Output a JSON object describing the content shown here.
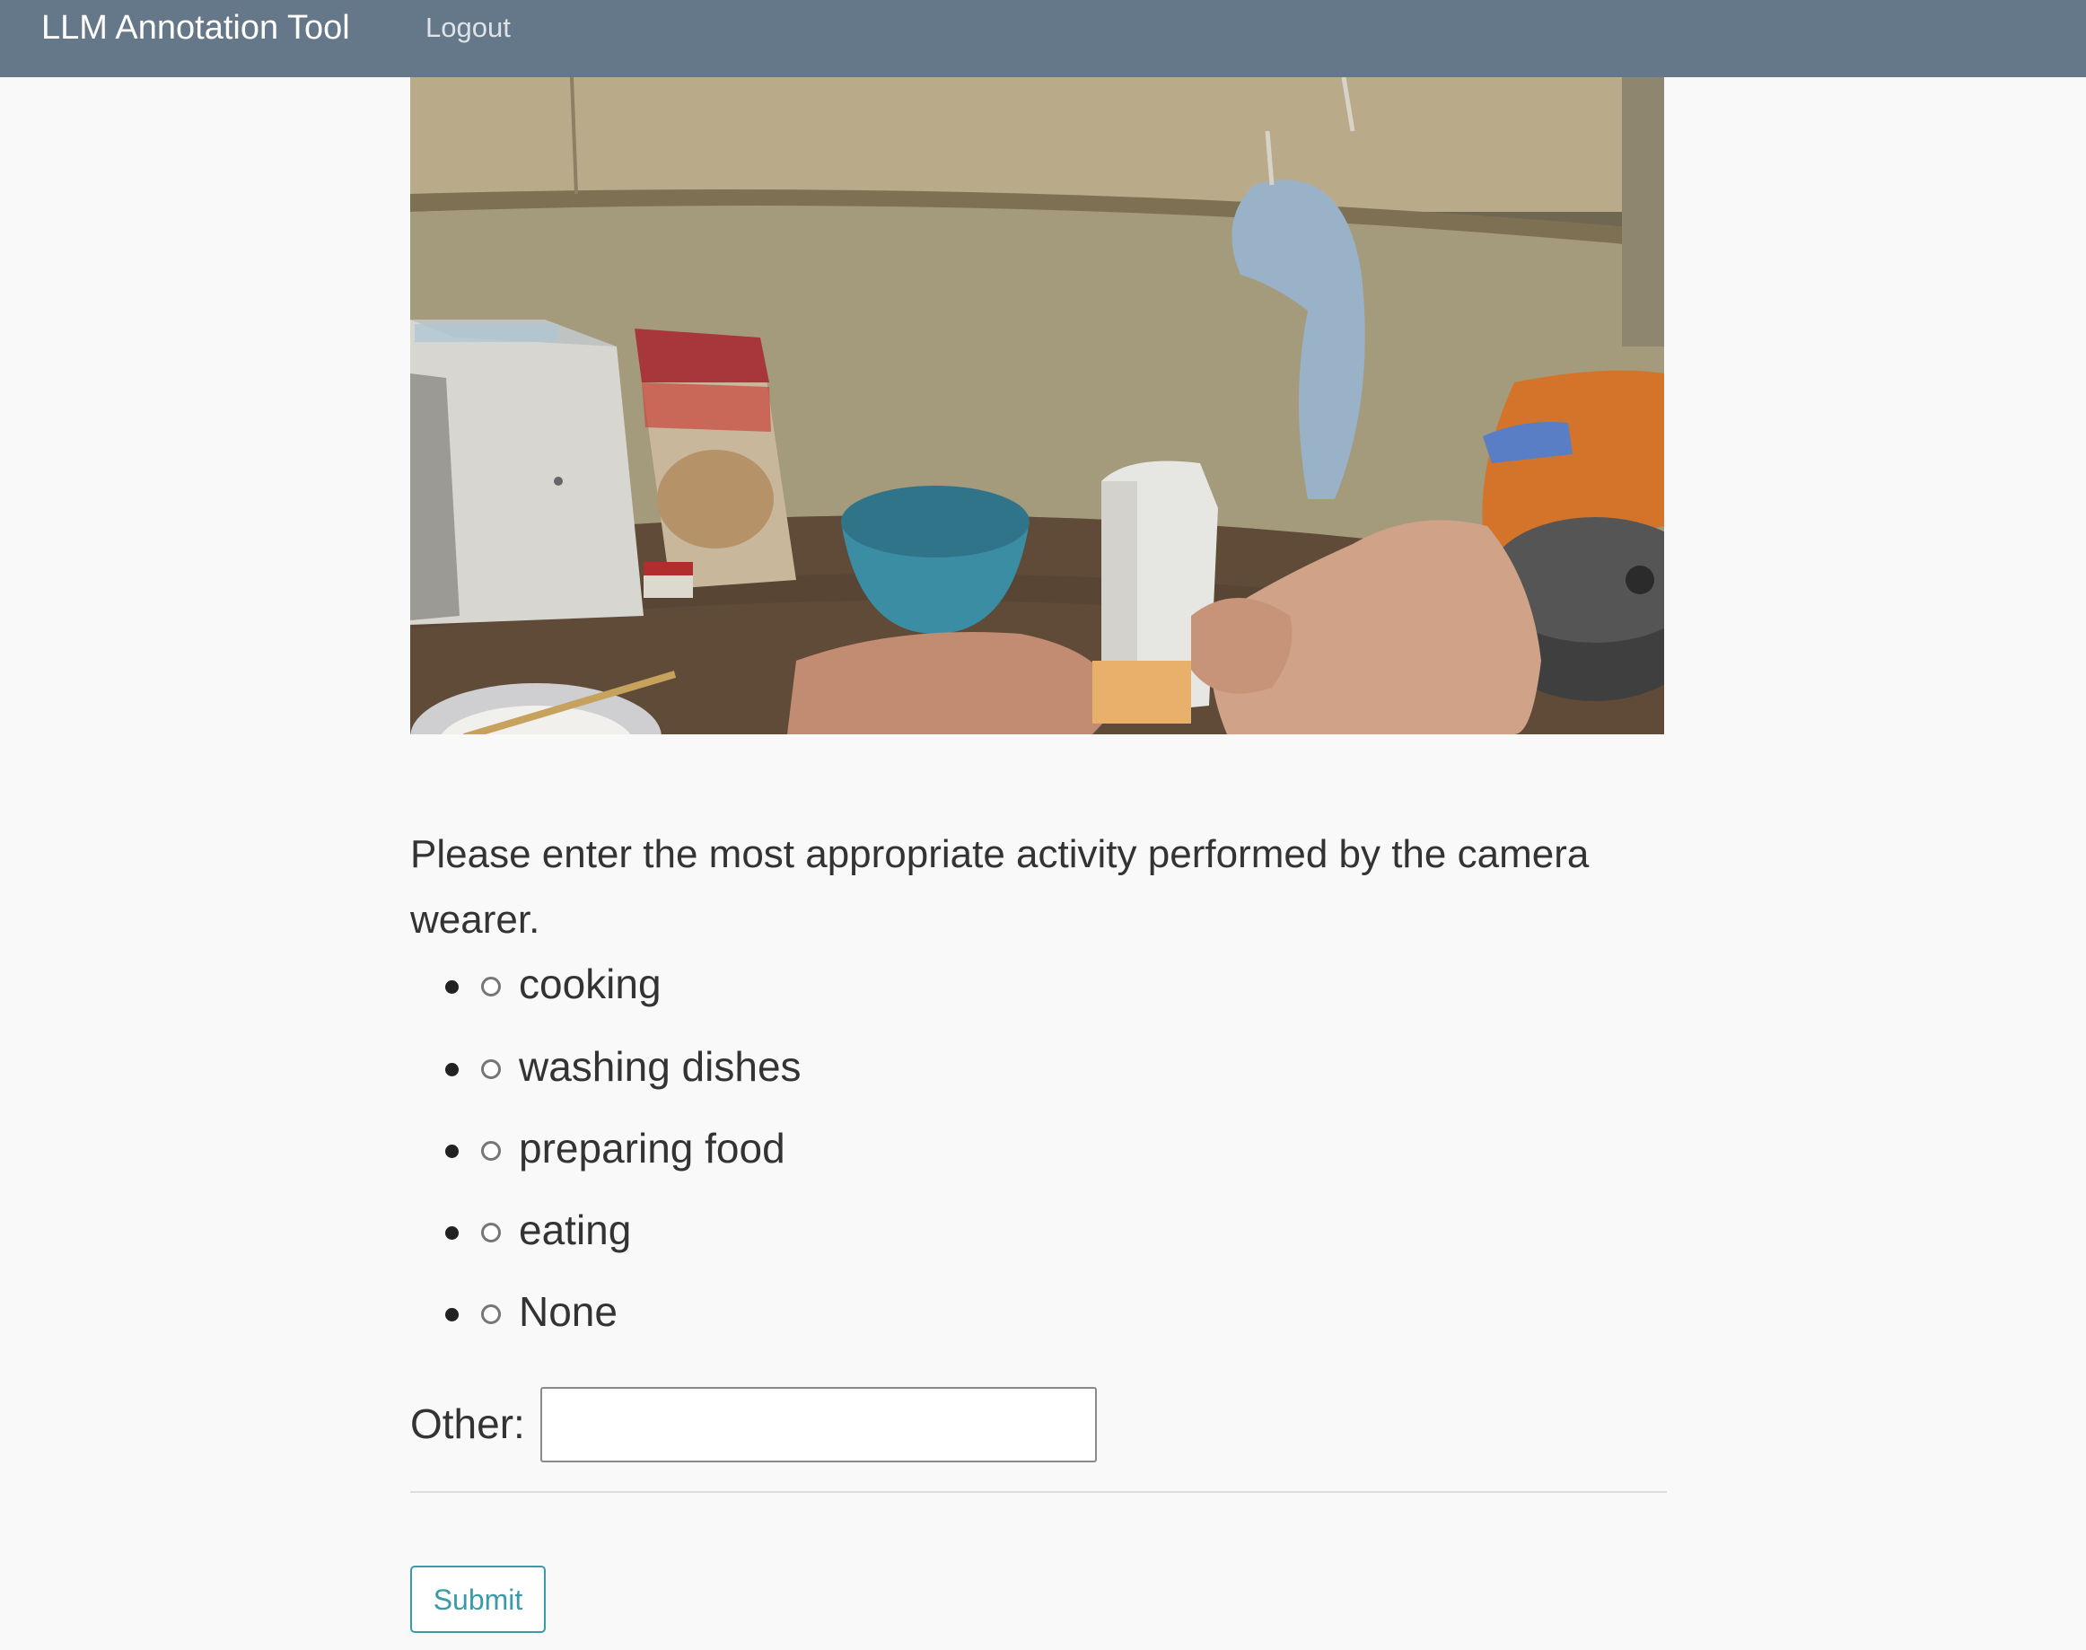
{
  "navbar": {
    "brand": "LLM Annotation Tool",
    "logout_label": "Logout"
  },
  "question": "Please enter the most appropriate activity performed by the camera wearer.",
  "options": [
    {
      "label": "cooking",
      "selected": false
    },
    {
      "label": "washing dishes",
      "selected": false
    },
    {
      "label": "preparing food",
      "selected": false
    },
    {
      "label": "eating",
      "selected": false
    },
    {
      "label": "None",
      "selected": false
    }
  ],
  "other": {
    "label": "Other:",
    "value": ""
  },
  "submit_label": "Submit",
  "colors": {
    "navbar_bg": "#647889",
    "page_bg": "#f9f9f9",
    "accent": "#3a9ba7"
  }
}
